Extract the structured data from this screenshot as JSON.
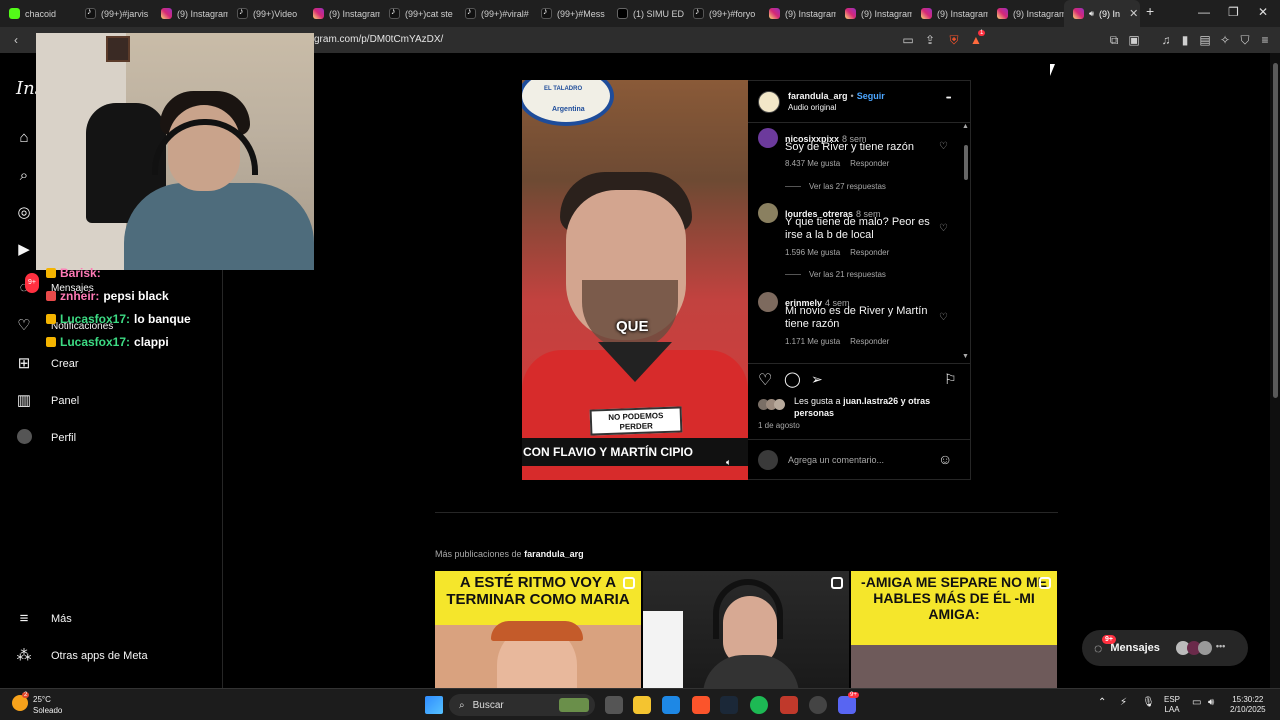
{
  "browser": {
    "tabs": [
      {
        "label": "chacoid",
        "icon": "kick"
      },
      {
        "label": "(99+)#jarvis",
        "icon": "tiktok"
      },
      {
        "label": "(9) Instagram",
        "icon": "instagram"
      },
      {
        "label": "(99+)Video",
        "icon": "tiktok"
      },
      {
        "label": "(9) Instagram",
        "icon": "instagram"
      },
      {
        "label": "(99+)cat ste",
        "icon": "tiktok"
      },
      {
        "label": "(99+)#viral#",
        "icon": "tiktok"
      },
      {
        "label": "(99+)#Mess",
        "icon": "tiktok"
      },
      {
        "label": "(1) SIMU ED",
        "icon": "x"
      },
      {
        "label": "(99+)#foryo",
        "icon": "tiktok"
      },
      {
        "label": "(9) Instagram",
        "icon": "instagram"
      },
      {
        "label": "(9) Instagram",
        "icon": "instagram"
      },
      {
        "label": "(9) Instagram",
        "icon": "instagram"
      },
      {
        "label": "(9) Instagram",
        "icon": "instagram"
      },
      {
        "label": "(9) In",
        "icon": "instagram",
        "active": true
      }
    ],
    "url": "gram.com/p/DM0tCmYAzDX/",
    "new_tab": "+",
    "minimize": "—",
    "maximize": "❐",
    "close": "✕",
    "shield_badge": "1"
  },
  "sidebar": {
    "logo": "Ins",
    "items": [
      {
        "label": "",
        "icon": "home-icon"
      },
      {
        "label": "",
        "icon": "search-icon"
      },
      {
        "label": "",
        "icon": "explore-icon"
      },
      {
        "label": "",
        "icon": "reels-icon"
      },
      {
        "label": "Mensajes",
        "icon": "messenger-icon",
        "badge": "9+"
      },
      {
        "label": "Notificaciones",
        "icon": "heart-icon"
      },
      {
        "label": "Crear",
        "icon": "plus-icon"
      },
      {
        "label": "Panel",
        "icon": "chart-icon"
      },
      {
        "label": "Perfil",
        "icon": "avatar-icon"
      }
    ],
    "more": "Más",
    "other_apps": "Otras apps de Meta"
  },
  "chat_overlay": [
    {
      "user": "Barisk:",
      "message": ""
    },
    {
      "user": "znheir:",
      "message": "pepsi black"
    },
    {
      "user": "Lucasfox17:",
      "message": "lo banque"
    },
    {
      "user": "Lucasfox17:",
      "message": "clappi"
    }
  ],
  "post": {
    "video_caption_word": "QUE",
    "sticker": "NO PODEMOS PERDER",
    "video_bottom_text": "CON FLAVIO Y MARTÍN CIPIO",
    "logo_text_top": "EL TALADRO",
    "logo_text_bottom": "Argentina",
    "author": "farandula_arg",
    "follow": "Seguir",
    "separator": "•",
    "audio": "Audio original",
    "more_options": "•••",
    "comments": [
      {
        "user": "nicosixxpixx",
        "time": "8 sem",
        "text": "Soy de River y tiene razón",
        "likes": "8.437 Me gusta",
        "reply": "Responder",
        "replies": "Ver las 27 respuestas"
      },
      {
        "user": "lourdes_otreras",
        "time": "8 sem",
        "text": "Y que tiene de malo? Peor es irse a la b de local",
        "likes": "1.596 Me gusta",
        "reply": "Responder",
        "replies": "Ver las 21 respuestas"
      },
      {
        "user": "erinmelv",
        "time": "4 sem",
        "text": "Mi novio es de River y Martín tiene razón",
        "likes": "1.171 Me gusta",
        "reply": "Responder"
      }
    ],
    "liked_by_prefix": "Les gusta a",
    "liked_by_user": "juan.lastra26",
    "liked_by_suffix": "y otras personas",
    "date": "1 de agosto",
    "comment_placeholder": "Agrega un comentario...",
    "scroll_up": "▲",
    "scroll_down": "▼"
  },
  "more_posts": {
    "title_prefix": "Más publicaciones de",
    "title_user": "farandula_arg",
    "thumbs": [
      {
        "text": "A ESTÉ RITMO VOY A TERMINAR COMO MARIA"
      },
      {
        "text": ""
      },
      {
        "text": "-AMIGA ME SEPARE NO ME HABLES MÁS DE ÉL -MI AMIGA:"
      }
    ]
  },
  "messages_pill": {
    "label": "Mensajes",
    "badge": "9+"
  },
  "taskbar": {
    "weather_temp": "25°C",
    "weather_desc": "Soleado",
    "weather_badge": "2",
    "search": "Buscar",
    "lang": "ESP",
    "region": "LAA",
    "time": "15:30:22",
    "date": "2/10/2025",
    "discord_badge": "9+"
  },
  "colors": {
    "link": "#4ca6ff",
    "ig_badge": "#ff3040",
    "thumb_yellow": "#f5e62b"
  }
}
